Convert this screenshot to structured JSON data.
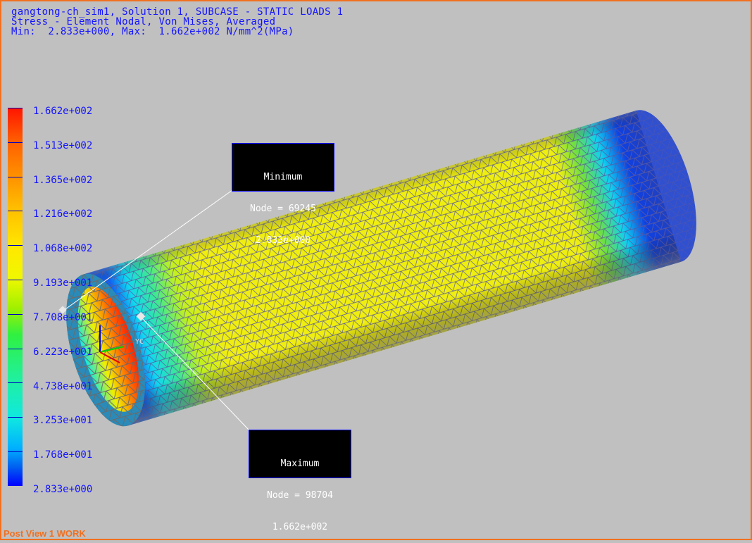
{
  "header": {
    "line1": "gangtong-ch_sim1, Solution 1, SUBCASE - STATIC LOADS 1",
    "line2": "Stress - Element Nodal, Von Mises, Averaged",
    "line3": "Min:  2.833e+000, Max:  1.662e+002 N/mm^2(MPa)"
  },
  "legend": {
    "labels": [
      "1.662e+002",
      "1.513e+002",
      "1.365e+002",
      "1.216e+002",
      "1.068e+002",
      "9.193e+001",
      "7.708e+001",
      "6.223e+001",
      "4.738e+001",
      "3.253e+001",
      "1.768e+001",
      "2.833e+000"
    ],
    "colors": {
      "max": "#ff1400",
      "mid": "#f0f800",
      "min": "#0000ff"
    }
  },
  "minimum": {
    "title": "Minimum",
    "node": "Node = 69245",
    "value": "2.833e+000"
  },
  "maximum": {
    "title": "Maximum",
    "node": "Node = 98704",
    "value": "1.662e+002"
  },
  "triad": {
    "label": "YC"
  },
  "status": "Post View  1 WORK",
  "colors": {
    "background": "#c0c0c0",
    "text": "#1414ff",
    "border": "#f07020"
  }
}
